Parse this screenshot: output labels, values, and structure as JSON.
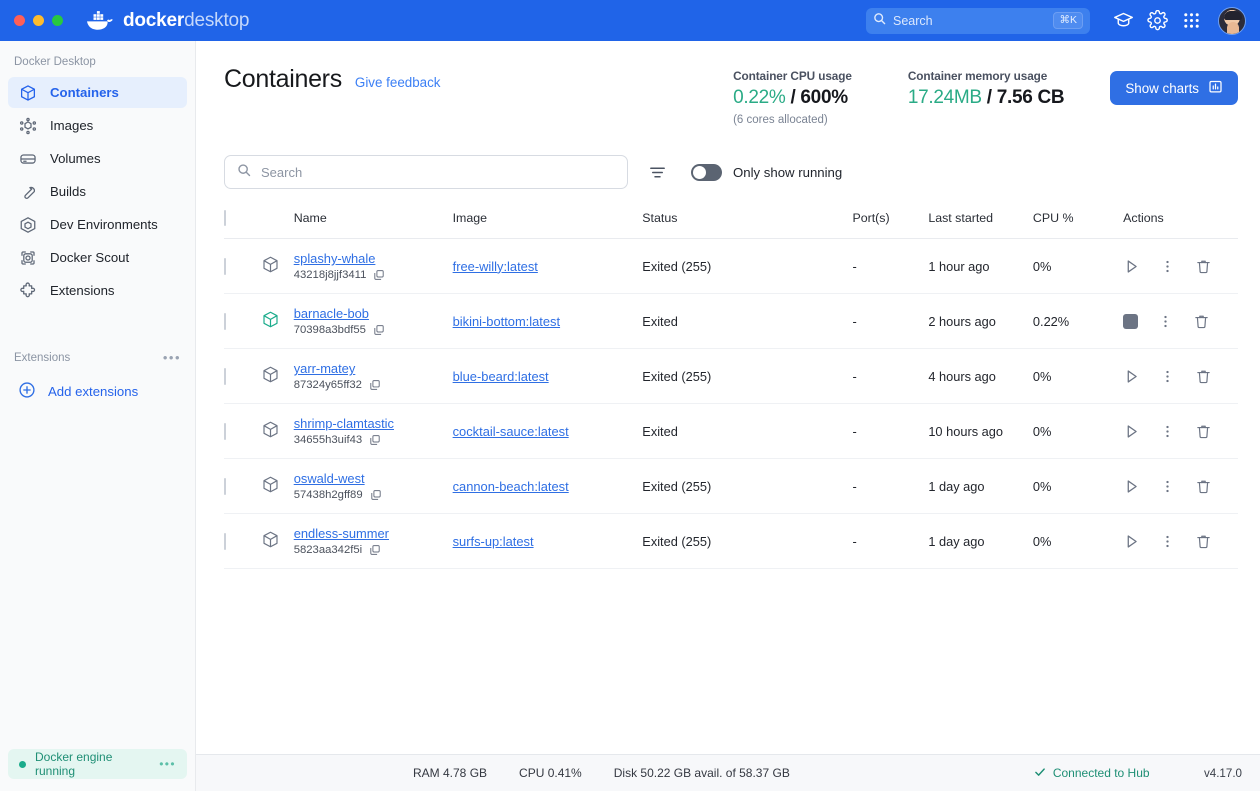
{
  "titlebar": {
    "brand_bold": "docker",
    "brand_light": "desktop",
    "search_placeholder": "Search",
    "search_shortcut": "⌘K",
    "icons": [
      "learning-center-icon",
      "settings-gear-icon",
      "apps-grid-icon",
      "user-avatar"
    ]
  },
  "sidebar": {
    "caption": "Docker Desktop",
    "items": [
      {
        "label": "Containers",
        "icon": "container-cube-icon",
        "active": true
      },
      {
        "label": "Images",
        "icon": "images-icon",
        "active": false
      },
      {
        "label": "Volumes",
        "icon": "volumes-drive-icon",
        "active": false
      },
      {
        "label": "Builds",
        "icon": "wrench-icon",
        "active": false
      },
      {
        "label": "Dev Environments",
        "icon": "dev-environments-icon",
        "active": false
      },
      {
        "label": "Docker Scout",
        "icon": "docker-scout-icon",
        "active": false
      },
      {
        "label": "Extensions",
        "icon": "puzzle-piece-icon",
        "active": false
      }
    ],
    "extensions_caption": "Extensions",
    "extensions_more": "•••",
    "add_extensions": "Add extensions",
    "engine_status": "Docker engine running",
    "engine_more": "•••"
  },
  "header": {
    "title": "Containers",
    "feedback_link": "Give feedback",
    "cpu_caption": "Container CPU usage",
    "cpu_used": "0.22%",
    "cpu_sep": " / ",
    "cpu_total": "600%",
    "cpu_sub": "(6 cores allocated)",
    "mem_caption": "Container memory usage",
    "mem_used": "17.24MB",
    "mem_sep": " / ",
    "mem_total": "7.56 CB",
    "show_charts": "Show charts"
  },
  "filters": {
    "search_placeholder": "Search",
    "filter_icon": "filter-icon",
    "toggle_label": "Only show running",
    "toggle_on": false
  },
  "table": {
    "columns": [
      "Name",
      "Image",
      "Status",
      "Port(s)",
      "Last started",
      "CPU %",
      "Actions"
    ],
    "rows": [
      {
        "name": "splashy-whale",
        "id": "43218j8jjf3411",
        "image": "free-willy:latest",
        "status": "Exited (255)",
        "ports": "-",
        "last_started": "1 hour ago",
        "cpu": "0%",
        "running": false
      },
      {
        "name": "barnacle-bob",
        "id": "70398a3bdf55",
        "image": "bikini-bottom:latest",
        "status": "Exited",
        "ports": "-",
        "last_started": "2 hours ago",
        "cpu": "0.22%",
        "running": true
      },
      {
        "name": "yarr-matey",
        "id": "87324y65ff32",
        "image": "blue-beard:latest",
        "status": "Exited (255)",
        "ports": "-",
        "last_started": "4 hours ago",
        "cpu": "0%",
        "running": false
      },
      {
        "name": "shrimp-clamtastic",
        "id": "34655h3uif43",
        "image": "cocktail-sauce:latest",
        "status": "Exited",
        "ports": "-",
        "last_started": "10 hours ago",
        "cpu": "0%",
        "running": false
      },
      {
        "name": "oswald-west",
        "id": "57438h2gff89",
        "image": "cannon-beach:latest",
        "status": "Exited (255)",
        "ports": "-",
        "last_started": "1 day ago",
        "cpu": "0%",
        "running": false
      },
      {
        "name": "endless-summer",
        "id": "5823aa342f5i",
        "image": "surfs-up:latest",
        "status": "Exited (255)",
        "ports": "-",
        "last_started": "1 day ago",
        "cpu": "0%",
        "running": false
      }
    ]
  },
  "statusbar": {
    "ram": "RAM 4.78 GB",
    "cpu": "CPU 0.41%",
    "disk": "Disk 50.22 GB avail. of 58.37 GB",
    "hub": "Connected to Hub",
    "version": "v4.17.0"
  },
  "colors": {
    "brand_blue": "#2064e8",
    "accent_blue": "#2f6fe4",
    "green": "#2aab86",
    "running_cube": "#1aab8b"
  }
}
